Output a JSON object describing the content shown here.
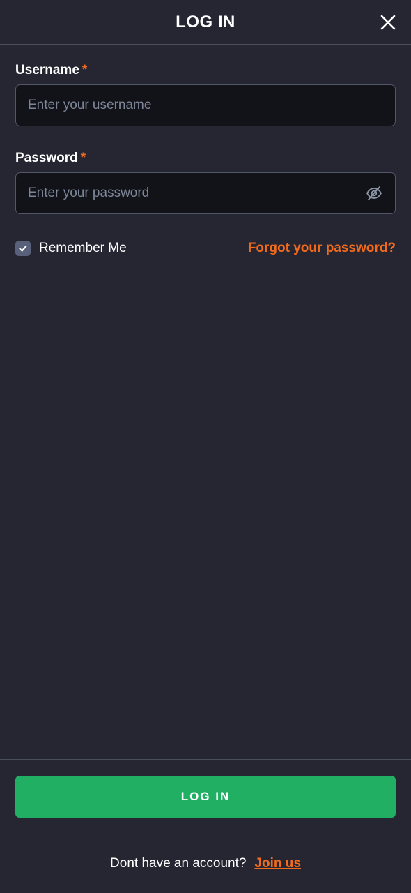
{
  "header": {
    "title": "LOG IN",
    "close_icon": "close-icon"
  },
  "form": {
    "username": {
      "label": "Username",
      "required_mark": "*",
      "value": "",
      "placeholder": "Enter your username"
    },
    "password": {
      "label": "Password",
      "required_mark": "*",
      "value": "",
      "placeholder": "Enter your password",
      "toggle_icon": "eye-slash-icon"
    },
    "remember": {
      "label": "Remember Me",
      "checked": true
    },
    "forgot_link": "Forgot your password?"
  },
  "footer": {
    "login_button": "LOG IN",
    "no_account_text": "Dont have an account?",
    "join_link": "Join us"
  },
  "colors": {
    "background": "#262633",
    "input_bg": "#121318",
    "accent_orange": "#f26b1d",
    "primary_green": "#21b063",
    "divider": "#4a4f5e"
  }
}
